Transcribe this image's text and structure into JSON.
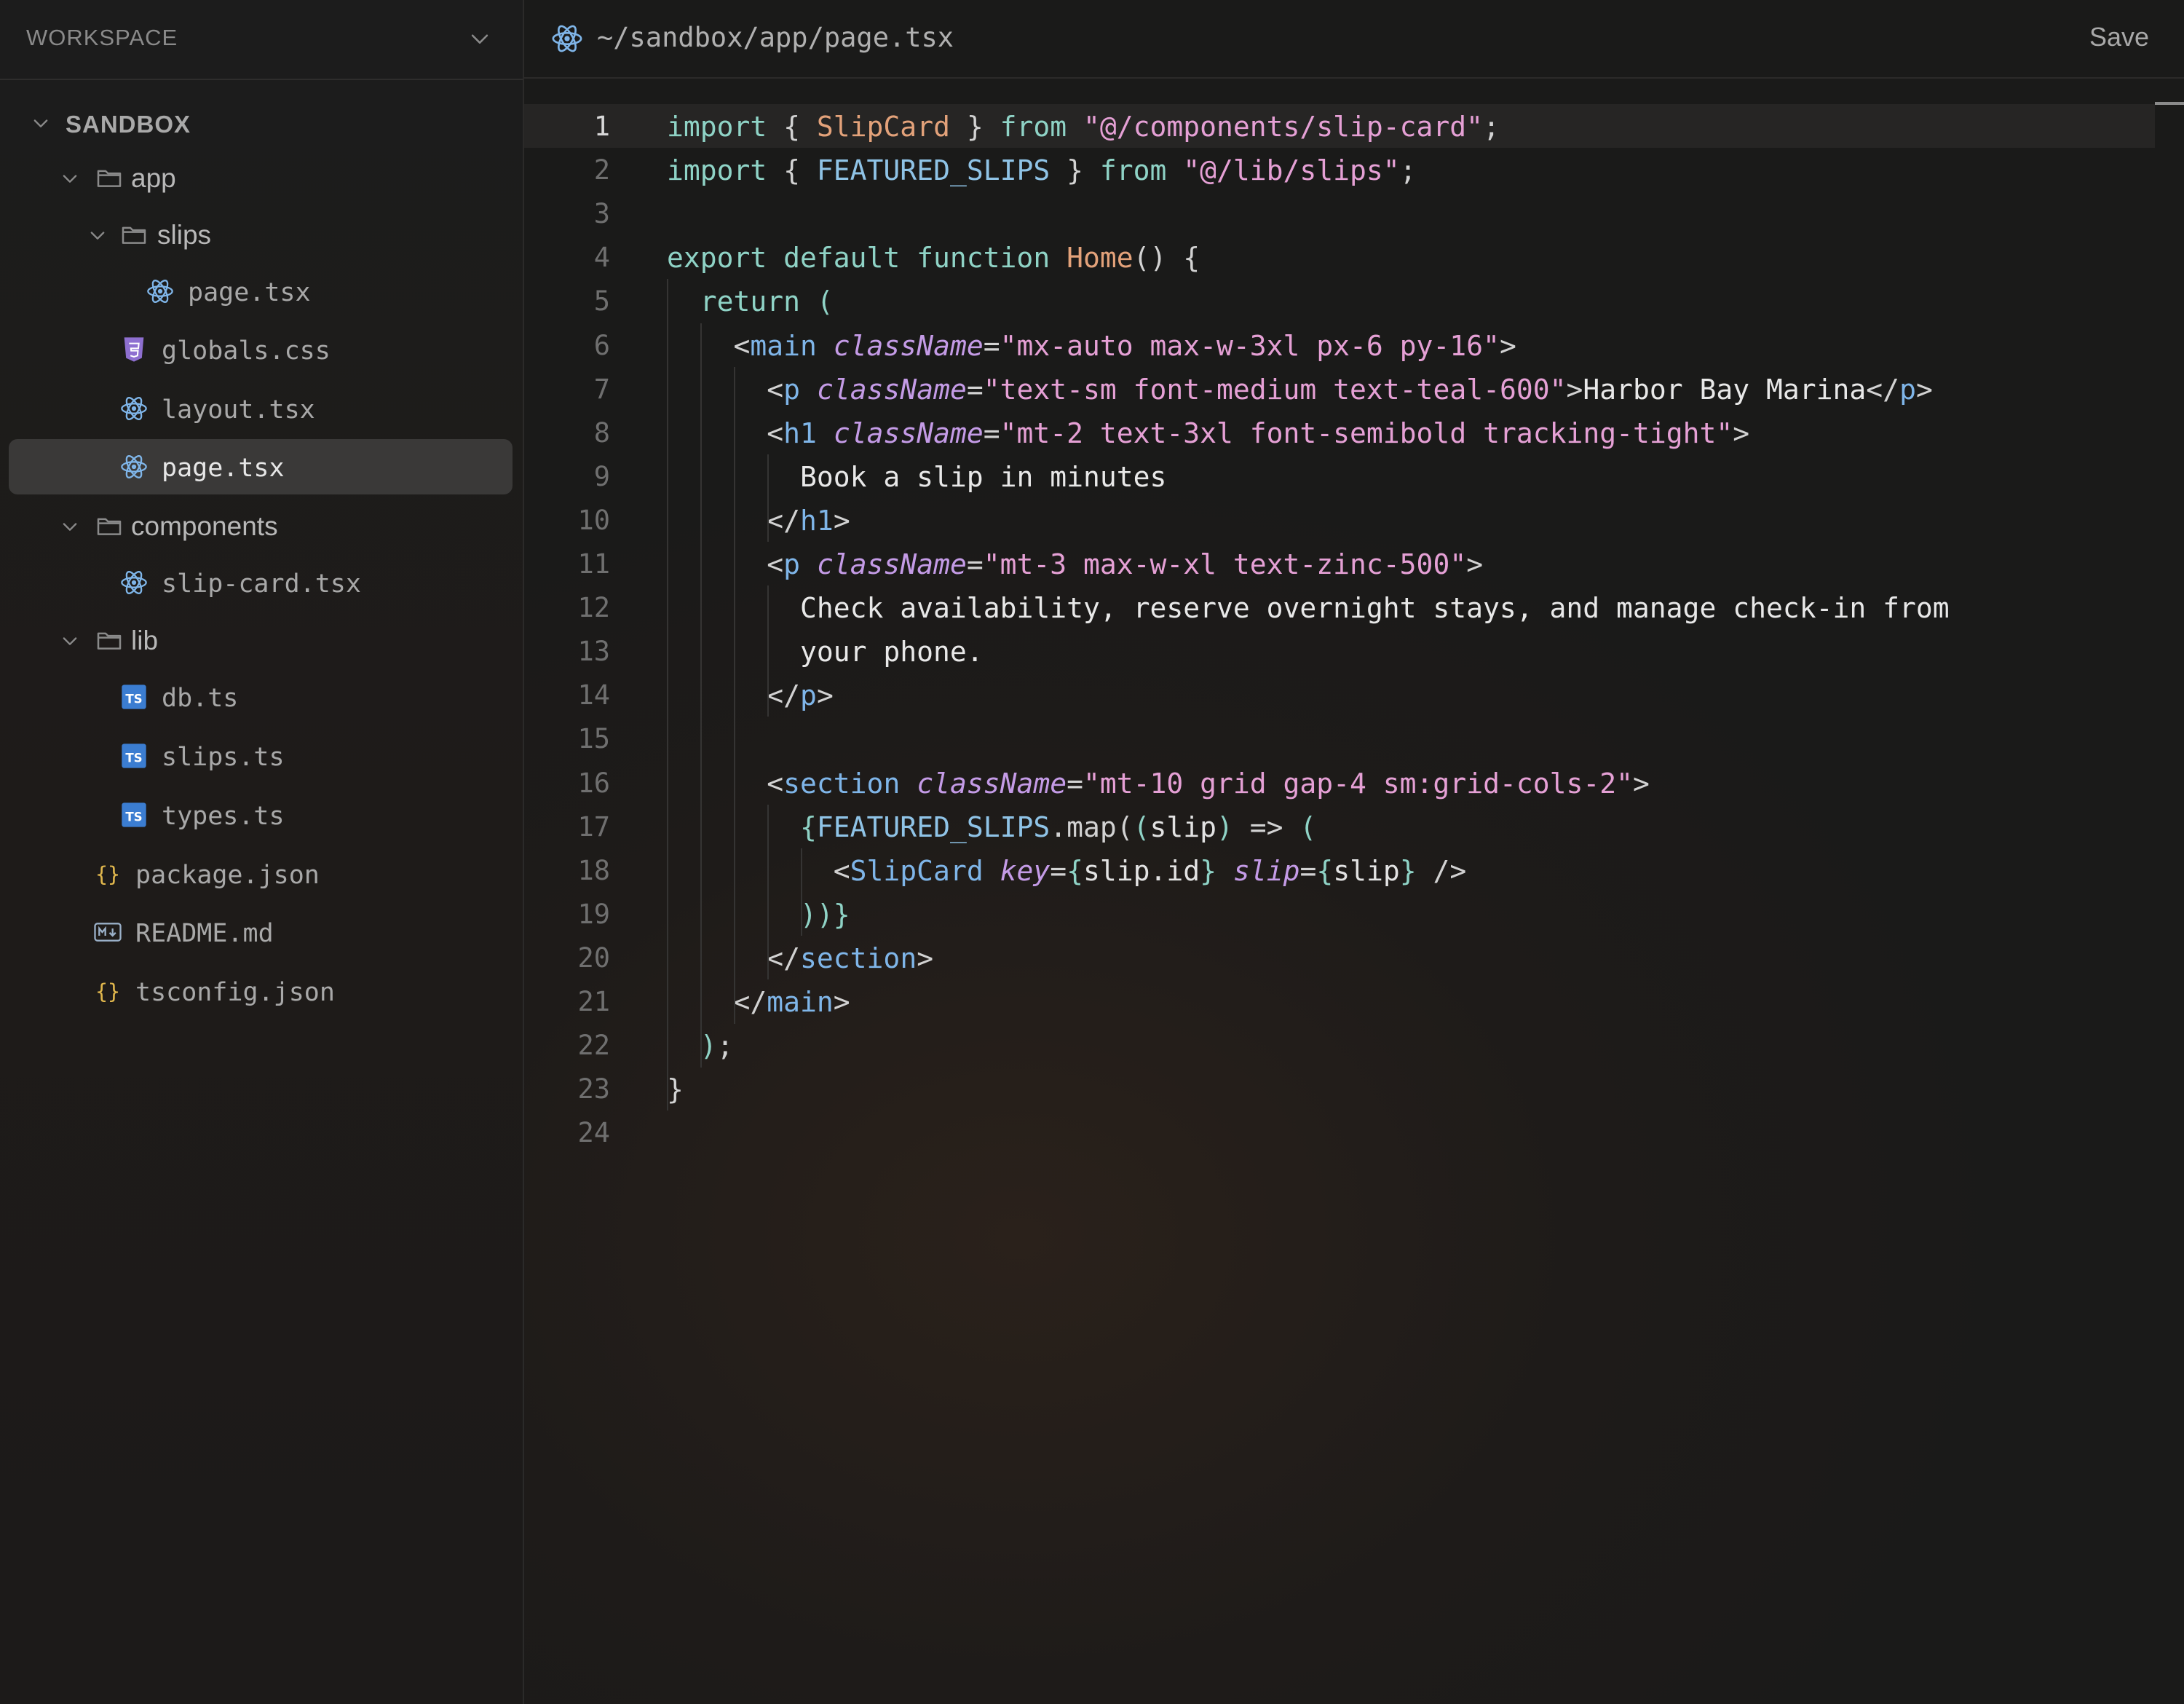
{
  "sidebar": {
    "title": "WORKSPACE",
    "tree": [
      {
        "label": "SANDBOX",
        "kind": "root",
        "icon": "chevron-down-icon"
      },
      {
        "label": "app",
        "kind": "folder",
        "icon": "folder-icon"
      },
      {
        "label": "slips",
        "kind": "folder",
        "icon": "folder-icon"
      },
      {
        "label": "page.tsx",
        "kind": "file",
        "icon": "react-icon"
      },
      {
        "label": "globals.css",
        "kind": "file",
        "icon": "css-icon"
      },
      {
        "label": "layout.tsx",
        "kind": "file",
        "icon": "react-icon"
      },
      {
        "label": "page.tsx",
        "kind": "file",
        "icon": "react-icon",
        "active": true
      },
      {
        "label": "components",
        "kind": "folder",
        "icon": "folder-icon"
      },
      {
        "label": "slip-card.tsx",
        "kind": "file",
        "icon": "react-icon"
      },
      {
        "label": "lib",
        "kind": "folder",
        "icon": "folder-icon"
      },
      {
        "label": "db.ts",
        "kind": "file",
        "icon": "typescript-icon"
      },
      {
        "label": "slips.ts",
        "kind": "file",
        "icon": "typescript-icon"
      },
      {
        "label": "types.ts",
        "kind": "file",
        "icon": "typescript-icon"
      },
      {
        "label": "package.json",
        "kind": "file",
        "icon": "json-icon"
      },
      {
        "label": "README.md",
        "kind": "file",
        "icon": "markdown-icon"
      },
      {
        "label": "tsconfig.json",
        "kind": "file",
        "icon": "json-icon"
      }
    ]
  },
  "editor": {
    "path": "~/sandbox/app/page.tsx",
    "save_label": "Save",
    "current_line": 1,
    "lines": [
      [
        [
          "t-kw",
          "import "
        ],
        [
          "t-punc",
          "{ "
        ],
        [
          "t-cls",
          "SlipCard"
        ],
        [
          "t-punc",
          " } "
        ],
        [
          "t-kw",
          "from "
        ],
        [
          "t-str",
          "\"@/components/slip-card\""
        ],
        [
          "t-punc",
          ";"
        ]
      ],
      [
        [
          "t-kw",
          "import "
        ],
        [
          "t-punc",
          "{ "
        ],
        [
          "t-const",
          "FEATURED_SLIPS"
        ],
        [
          "t-punc",
          " } "
        ],
        [
          "t-kw",
          "from "
        ],
        [
          "t-str",
          "\"@/lib/slips\""
        ],
        [
          "t-punc",
          ";"
        ]
      ],
      [],
      [
        [
          "t-kw",
          "export default function "
        ],
        [
          "t-fn",
          "Home"
        ],
        [
          "t-punc",
          "() {"
        ]
      ],
      [
        [
          "t-punc",
          "  "
        ],
        [
          "t-kw",
          "return "
        ],
        [
          "t-brace",
          "("
        ]
      ],
      [
        [
          "t-punc",
          "    "
        ],
        [
          "t-punc",
          "<"
        ],
        [
          "t-tag",
          "main "
        ],
        [
          "t-attr",
          "className"
        ],
        [
          "t-punc",
          "="
        ],
        [
          "t-str",
          "\"mx-auto max-w-3xl px-6 py-16\""
        ],
        [
          "t-punc",
          ">"
        ]
      ],
      [
        [
          "t-punc",
          "      "
        ],
        [
          "t-punc",
          "<"
        ],
        [
          "t-tag",
          "p "
        ],
        [
          "t-attr",
          "className"
        ],
        [
          "t-punc",
          "="
        ],
        [
          "t-str",
          "\"text-sm font-medium text-teal-600\""
        ],
        [
          "t-punc",
          ">"
        ],
        [
          "t-txt",
          "Harbor Bay Marina"
        ],
        [
          "t-punc",
          "</"
        ],
        [
          "t-tag",
          "p"
        ],
        [
          "t-punc",
          ">"
        ]
      ],
      [
        [
          "t-punc",
          "      "
        ],
        [
          "t-punc",
          "<"
        ],
        [
          "t-tag",
          "h1 "
        ],
        [
          "t-attr",
          "className"
        ],
        [
          "t-punc",
          "="
        ],
        [
          "t-str",
          "\"mt-2 text-3xl font-semibold tracking-tight\""
        ],
        [
          "t-punc",
          ">"
        ]
      ],
      [
        [
          "t-punc",
          "        "
        ],
        [
          "t-txt",
          "Book a slip in minutes"
        ]
      ],
      [
        [
          "t-punc",
          "      "
        ],
        [
          "t-punc",
          "</"
        ],
        [
          "t-tag",
          "h1"
        ],
        [
          "t-punc",
          ">"
        ]
      ],
      [
        [
          "t-punc",
          "      "
        ],
        [
          "t-punc",
          "<"
        ],
        [
          "t-tag",
          "p "
        ],
        [
          "t-attr",
          "className"
        ],
        [
          "t-punc",
          "="
        ],
        [
          "t-str",
          "\"mt-3 max-w-xl text-zinc-500\""
        ],
        [
          "t-punc",
          ">"
        ]
      ],
      [
        [
          "t-punc",
          "        "
        ],
        [
          "t-txt",
          "Check availability, reserve overnight stays, and manage check-in from"
        ]
      ],
      [
        [
          "t-punc",
          "        "
        ],
        [
          "t-txt",
          "your phone."
        ]
      ],
      [
        [
          "t-punc",
          "      "
        ],
        [
          "t-punc",
          "</"
        ],
        [
          "t-tag",
          "p"
        ],
        [
          "t-punc",
          ">"
        ]
      ],
      [],
      [
        [
          "t-punc",
          "      "
        ],
        [
          "t-punc",
          "<"
        ],
        [
          "t-tag",
          "section "
        ],
        [
          "t-attr",
          "className"
        ],
        [
          "t-punc",
          "="
        ],
        [
          "t-str",
          "\"mt-10 grid gap-4 sm:grid-cols-2\""
        ],
        [
          "t-punc",
          ">"
        ]
      ],
      [
        [
          "t-punc",
          "        "
        ],
        [
          "t-brace",
          "{"
        ],
        [
          "t-const",
          "FEATURED_SLIPS"
        ],
        [
          "t-punc",
          ".map("
        ],
        [
          "t-brace",
          "("
        ],
        [
          "t-var",
          "slip"
        ],
        [
          "t-brace",
          ")"
        ],
        [
          "t-punc",
          " => "
        ],
        [
          "t-brace",
          "("
        ]
      ],
      [
        [
          "t-punc",
          "          "
        ],
        [
          "t-punc",
          "<"
        ],
        [
          "t-tag",
          "SlipCard "
        ],
        [
          "t-attr",
          "key"
        ],
        [
          "t-punc",
          "="
        ],
        [
          "t-brace",
          "{"
        ],
        [
          "t-var",
          "slip.id"
        ],
        [
          "t-brace",
          "}"
        ],
        [
          "t-punc",
          " "
        ],
        [
          "t-attr",
          "slip"
        ],
        [
          "t-punc",
          "="
        ],
        [
          "t-brace",
          "{"
        ],
        [
          "t-var",
          "slip"
        ],
        [
          "t-brace",
          "}"
        ],
        [
          "t-punc",
          " />"
        ]
      ],
      [
        [
          "t-punc",
          "        "
        ],
        [
          "t-brace",
          "))}"
        ]
      ],
      [
        [
          "t-punc",
          "      "
        ],
        [
          "t-punc",
          "</"
        ],
        [
          "t-tag",
          "section"
        ],
        [
          "t-punc",
          ">"
        ]
      ],
      [
        [
          "t-punc",
          "    "
        ],
        [
          "t-punc",
          "</"
        ],
        [
          "t-tag",
          "main"
        ],
        [
          "t-punc",
          ">"
        ]
      ],
      [
        [
          "t-punc",
          "  "
        ],
        [
          "t-brace",
          ")"
        ],
        [
          "t-punc",
          ";"
        ]
      ],
      [
        [
          "t-punc",
          "}"
        ]
      ],
      []
    ]
  },
  "colors": {
    "background": "#1b1a19",
    "active_row": "#3a3938",
    "keyword": "#8fd3c6",
    "string": "#e5a0d5",
    "tag": "#7fb5e8",
    "attribute": "#c49be6",
    "function": "#e3a27a"
  }
}
